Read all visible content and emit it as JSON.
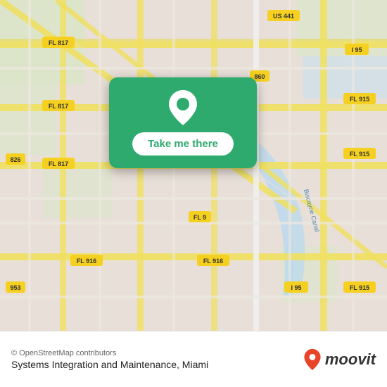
{
  "map": {
    "attribution": "© OpenStreetMap contributors",
    "background_color": "#e8e0d8"
  },
  "card": {
    "button_label": "Take me there",
    "background_color": "#2eaa6e"
  },
  "bottom_bar": {
    "attribution": "© OpenStreetMap contributors",
    "location_name": "Systems Integration and Maintenance, Miami",
    "brand_name": "moovit"
  },
  "road_labels": [
    {
      "id": "fl817_top_left",
      "text": "FL 817"
    },
    {
      "id": "fl817_mid",
      "text": "FL 817"
    },
    {
      "id": "fl817_mid2",
      "text": "FL 817"
    },
    {
      "id": "fl817_btm",
      "text": "FL 817"
    },
    {
      "id": "us441",
      "text": "US 441"
    },
    {
      "id": "i95_top",
      "text": "I 95"
    },
    {
      "id": "fl915_top",
      "text": "FL 915"
    },
    {
      "id": "fl915_mid",
      "text": "FL 915"
    },
    {
      "id": "r826",
      "text": "826"
    },
    {
      "id": "r860",
      "text": "860"
    },
    {
      "id": "fl9",
      "text": "FL 9"
    },
    {
      "id": "fl916_left",
      "text": "FL 916"
    },
    {
      "id": "fl916_right",
      "text": "FL 916"
    },
    {
      "id": "i95_btm",
      "text": "I 95"
    },
    {
      "id": "fl915_btm",
      "text": "FL 915"
    },
    {
      "id": "r953",
      "text": "953"
    },
    {
      "id": "biscayne_canal",
      "text": "Biscayne Canal"
    }
  ]
}
